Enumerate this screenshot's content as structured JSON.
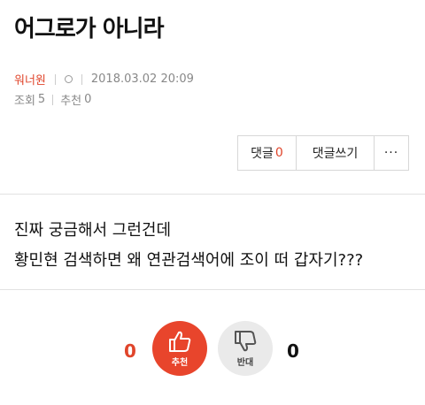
{
  "post": {
    "title": "어그로가 아니라",
    "author": "워너원",
    "date": "2018.03.02 20:09",
    "views_label": "조회",
    "views": "5",
    "recommend_label": "추천",
    "recommend": "0",
    "content_lines": [
      "진짜 궁금해서 그런건데",
      "황민현 검색하면 왜 연관검색어에 조이 떠 갑자기???"
    ]
  },
  "toolbar": {
    "comment_label": "댓글",
    "comment_count": "0",
    "write_label": "댓글쓰기",
    "more_label": "···"
  },
  "vote": {
    "up_count": "0",
    "up_label": "추천",
    "down_count": "0",
    "down_label": "반대",
    "colors": {
      "up": "#e8452c",
      "down": "#eaeaea",
      "accent": "#e0452b"
    }
  }
}
